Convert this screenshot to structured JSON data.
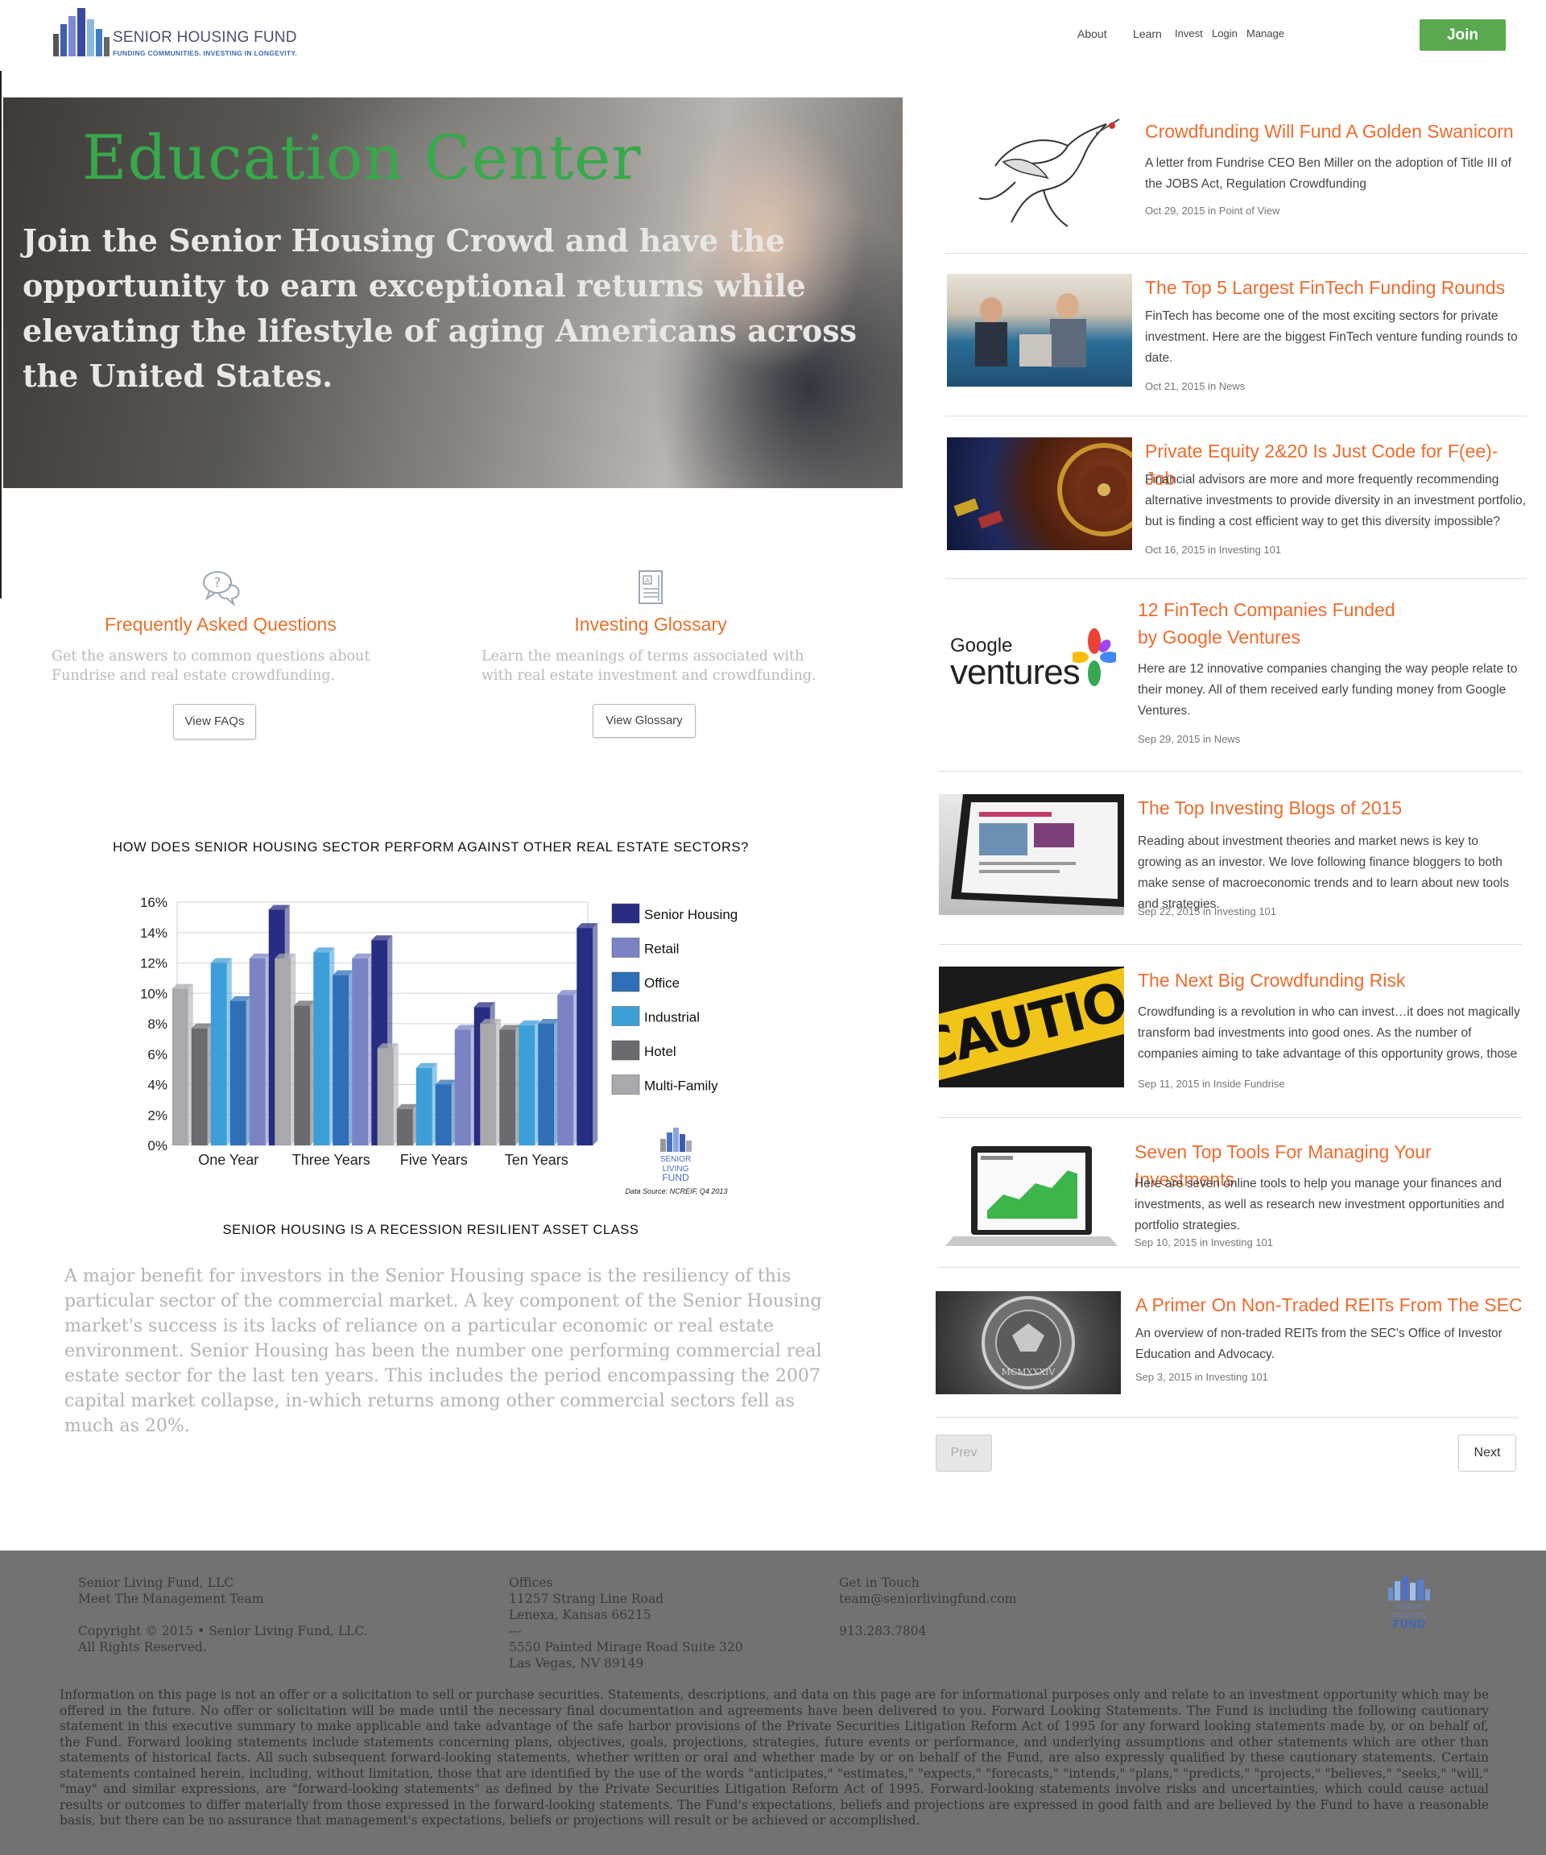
{
  "header": {
    "logo_name": "SENIOR HOUSING FUND",
    "logo_tagline": "FUNDING COMMUNITIES. INVESTING IN LONGEVITY.",
    "nav": [
      "About",
      "Learn",
      "Invest",
      "Login",
      "Manage"
    ],
    "join_label": "Join",
    "join_color": "#5aa84f"
  },
  "hero": {
    "title": "Education Center",
    "text": "Join the Senior Housing Crowd and have the opportunity to earn exceptional returns while elevating the lifestyle of aging Americans across the United States."
  },
  "features": {
    "faq": {
      "title": "Frequently Asked Questions",
      "desc": "Get the answers to common questions about Fundrise and real estate crowdfunding.",
      "button": "View FAQs",
      "icon": "chat-question-icon"
    },
    "glossary": {
      "title": "Investing Glossary",
      "desc": "Learn the meanings of terms associated with with real estate investment and crowdfunding.",
      "button": "View Glossary",
      "icon": "document-icon"
    }
  },
  "chart_heading": "HOW DOES SENIOR HOUSING SECTOR PERFORM AGAINST OTHER REAL ESTATE SECTORS?",
  "chart_data": {
    "type": "bar",
    "categories": [
      "One Year",
      "Three Years",
      "Five Years",
      "Ten Years"
    ],
    "series": [
      {
        "name": "Multi-Family",
        "values": [
          10.3,
          12.3,
          6.4,
          8.0
        ],
        "color": "#a9a9ad"
      },
      {
        "name": "Hotel",
        "values": [
          7.7,
          9.2,
          2.4,
          7.6
        ],
        "color": "#6b6b6f"
      },
      {
        "name": "Industrial",
        "values": [
          12.0,
          12.7,
          5.1,
          7.9
        ],
        "color": "#3d9fd8"
      },
      {
        "name": "Office",
        "values": [
          9.5,
          11.2,
          4.0,
          8.0
        ],
        "color": "#2e6fb7"
      },
      {
        "name": "Retail",
        "values": [
          12.3,
          12.3,
          7.6,
          9.9
        ],
        "color": "#7a84c4"
      },
      {
        "name": "Senior Housing",
        "values": [
          15.5,
          13.5,
          9.1,
          14.3
        ],
        "color": "#262d82"
      }
    ],
    "legend_order": [
      "Senior Housing",
      "Retail",
      "Office",
      "Industrial",
      "Hotel",
      "Multi-Family"
    ],
    "yticks": [
      "0%",
      "2%",
      "4%",
      "6%",
      "8%",
      "10%",
      "12%",
      "14%",
      "16%"
    ],
    "ylim": [
      0,
      16
    ],
    "source": "Data Source: NCREIF, Q4 2013",
    "logo_text": [
      "SENIOR",
      "LIVING",
      "FUND"
    ],
    "grid": true,
    "legend_position": "right"
  },
  "chart_caption": "SENIOR HOUSING IS A RECESSION RESILIENT ASSET CLASS",
  "chart_paragraph": "A major benefit for investors in the Senior Housing space is the resiliency of this particular sector of the commercial market. A key component of the Senior Housing market's success is its lacks of reliance on a particular economic or real estate environment. Senior Housing has been the number one performing commercial real estate sector for the last ten years. This includes the period encompassing the 2007 capital market collapse, in-which returns among other commercial sectors fell as much as 20%.",
  "articles": [
    {
      "title": "Crowdfunding Will Fund A Golden Swanicorn",
      "excerpt": "A letter from Fundrise CEO Ben Miller on the adoption of Title III of the JOBS Act, Regulation Crowdfunding",
      "meta": "Oct 29, 2015 in Point of View",
      "thumb": "swanicorn-illustration"
    },
    {
      "title": "The Top 5 Largest FinTech Funding Rounds",
      "excerpt": "FinTech has become one of the most exciting sectors for private investment. Here are the biggest FinTech venture funding rounds to date.",
      "meta": "Oct 21, 2015 in News",
      "thumb": "office-meeting-photo"
    },
    {
      "title": "Private Equity 2&20 Is Just Code for F(ee)-Job",
      "excerpt": "Financial advisors are more and more frequently recommending alternative investments to provide diversity in an investment portfolio, but is finding a cost efficient way to get this diversity impossible?",
      "meta": "Oct 16, 2015 in Investing 101",
      "thumb": "roulette-photo"
    },
    {
      "title": "12 FinTech Companies Funded by Google Ventures",
      "excerpt": "Here are 12 innovative companies changing the way people relate to their money. All of them received early funding money from Google Ventures.",
      "meta": "Sep 29, 2015 in News",
      "thumb": "google-ventures-logo",
      "logo_small": "Google",
      "logo_big": "ventures"
    },
    {
      "title": "The Top Investing Blogs of 2015",
      "excerpt": "Reading about investment theories and market news is key to growing as an investor. We love following finance bloggers to both make sense of macroeconomic trends and to learn about new tools and strategies.",
      "meta": "Sep 22, 2015 in Investing 101",
      "thumb": "laptop-photo"
    },
    {
      "title": "The Next Big Crowdfunding Risk",
      "excerpt": "Crowdfunding is a revolution in who can invest…it does not magically transform bad investments into good ones. As the number of companies aiming to take advantage of this opportunity grows, those",
      "meta": "Sep 11, 2015 in Inside Fundrise",
      "thumb": "caution-tape-photo",
      "tape_text": "CAUTION"
    },
    {
      "title": "Seven Top Tools For Managing Your Investments",
      "excerpt": "Here are seven online tools to help you manage your finances and investments, as well as research new investment opportunities and portfolio strategies.",
      "meta": "Sep 10, 2015 in Investing 101",
      "thumb": "laptop-chart-photo"
    },
    {
      "title": "A Primer On Non-Traded REITs From The SEC",
      "excerpt": "An overview of non-traded REITs from the SEC's Office of Investor Education and Advocacy.",
      "meta": "Sep 3, 2015 in Investing 101",
      "thumb": "sec-seal-photo",
      "seal_text": "MCMXXXIV"
    }
  ],
  "pager": {
    "prev": "Prev",
    "next": "Next"
  },
  "footer": {
    "col1": "Senior Living Fund, LLC\nMeet The Management Team\n\nCopyright © 2015 • Senior Living Fund, LLC.\nAll Rights Reserved.",
    "col2": "Offices\n11257 Strang Line Road\nLenexa, Kansas 66215\n---\n5550 Painted Mirage Road Suite 320\nLas Vegas, NV 89149",
    "col3": "Get in Touch\nteam@seniorlivingfund.com\n\n913.283.7804",
    "logo_text": [
      "SENIOR",
      "HOUSING",
      "FUND"
    ],
    "disclaimer": "Information on this page is not an offer or a solicitation to sell or purchase securities. Statements, descriptions, and data on this page are for informational purposes only and relate to an investment opportunity which may be offered in the future. No offer or solicitation will be made until the necessary final documentation and agreements have been delivered to you. Forward Looking Statements. The Fund is including the following cautionary statement in this executive summary to make applicable and take advantage of the safe harbor provisions of the Private Securities Litigation Reform Act of 1995 for any forward looking statements made by, or on behalf of, the Fund. Forward looking statements include statements concerning plans, objectives, goals, projections, strategies, future events or performance, and underlying assumptions and other statements which are other than statements of historical facts. All such subsequent forward-looking statements, whether written or oral and whether made by or on behalf of the Fund, are also expressly qualified by these cautionary statements. Certain statements contained herein, including, without limitation, those that are identified by the use of the words \"anticipates,\" \"estimates,\" \"expects,\" \"forecasts,\" \"intends,\" \"plans,\" \"predicts,\" \"projects,\" \"believes,\" \"seeks,\" \"will,\" \"may\" and similar expressions, are \"forward-looking statements\" as defined by the Private Securities Litigation Reform Act of 1995. Forward-looking statements involve risks and uncertainties, which could cause actual results or outcomes to differ materially from those expressed in the forward-looking statements. The Fund's expectations, beliefs and projections are expressed in good faith and are believed by the Fund to have a reasonable basis, but there can be no assurance that management's expectations, beliefs or projections will result or be achieved or accomplished."
  }
}
